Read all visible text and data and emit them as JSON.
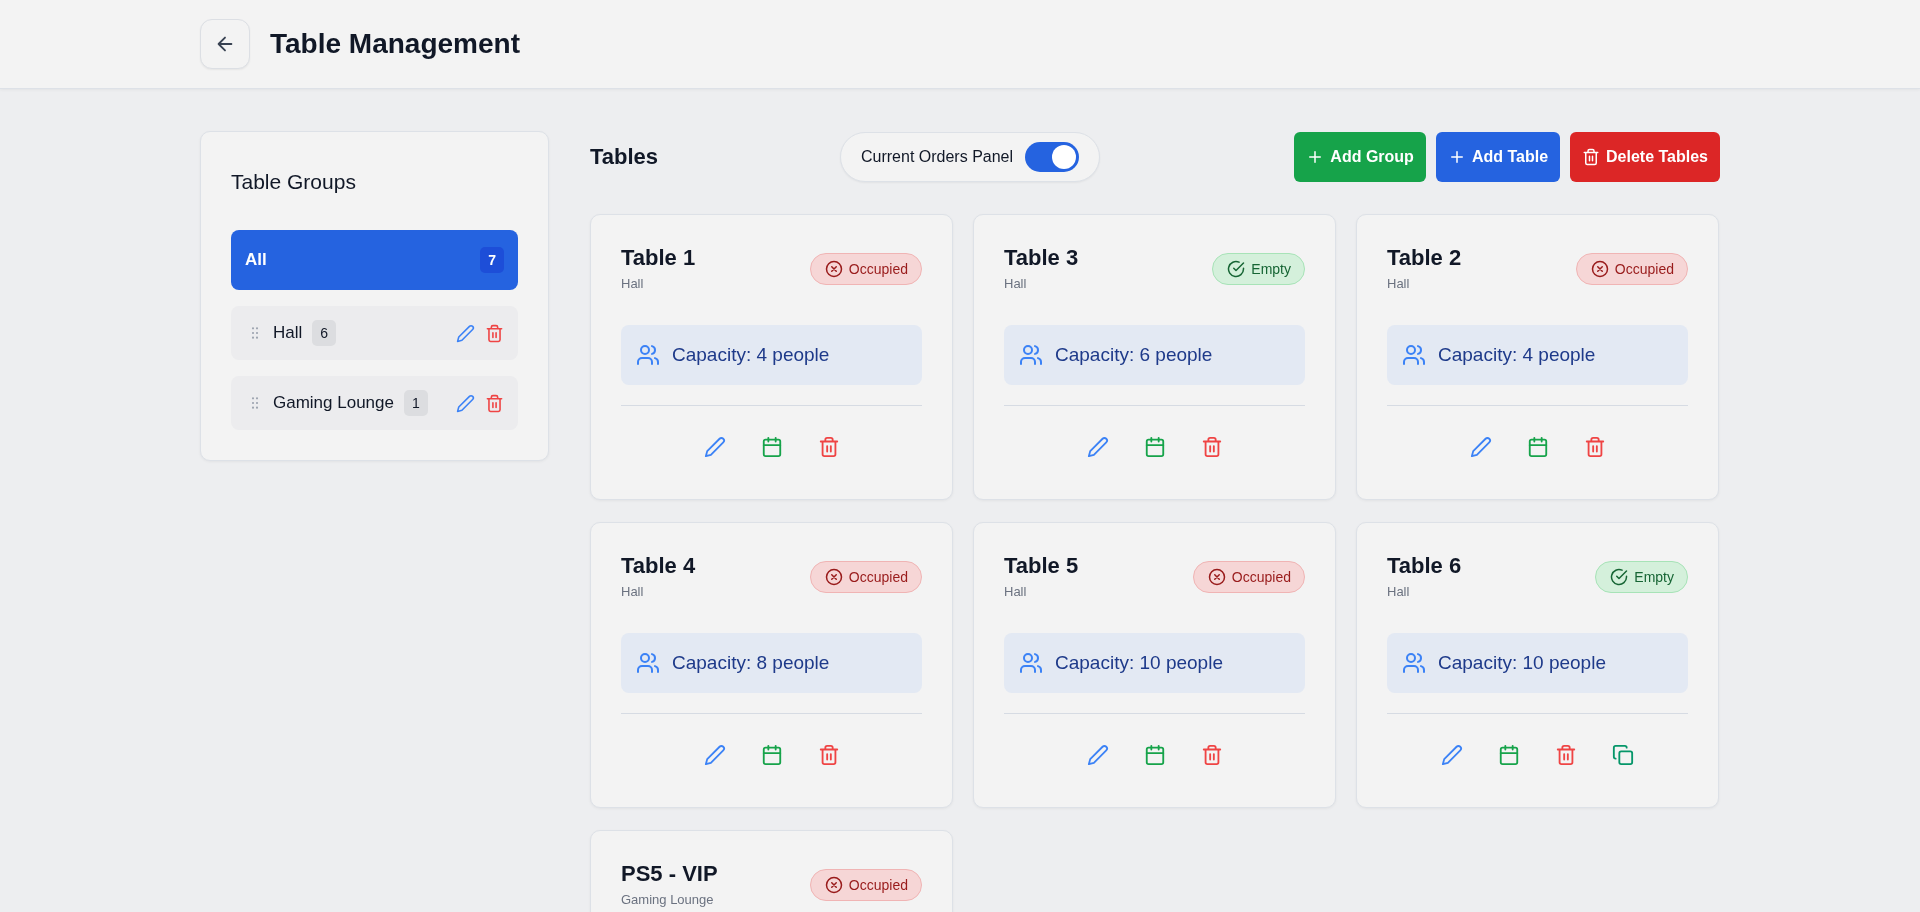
{
  "header": {
    "title": "Table Management"
  },
  "sidebar": {
    "title": "Table Groups",
    "items": [
      {
        "label": "All",
        "count": "7",
        "selected": true,
        "kind": "all"
      },
      {
        "label": "Hall",
        "count": "6",
        "selected": false,
        "kind": "group"
      },
      {
        "label": "Gaming Lounge",
        "count": "1",
        "selected": false,
        "kind": "group"
      }
    ]
  },
  "toolbar": {
    "title": "Tables",
    "panel_toggle": {
      "label": "Current Orders Panel",
      "on": true
    },
    "buttons": [
      {
        "label": "Add Group",
        "kind": "add-group"
      },
      {
        "label": "Add Table",
        "kind": "add-table"
      },
      {
        "label": "Delete Tables",
        "kind": "delete"
      }
    ]
  },
  "tables": [
    {
      "name": "Table 1",
      "group": "Hall",
      "status": "Occupied",
      "kind": "occupied",
      "capacity": "Capacity: 4 people",
      "actions": [
        {
          "kind": "edit"
        },
        {
          "kind": "schedule"
        },
        {
          "kind": "delete"
        }
      ]
    },
    {
      "name": "Table 3",
      "group": "Hall",
      "status": "Empty",
      "kind": "empty",
      "capacity": "Capacity: 6 people",
      "actions": [
        {
          "kind": "edit"
        },
        {
          "kind": "schedule"
        },
        {
          "kind": "delete"
        }
      ]
    },
    {
      "name": "Table 2",
      "group": "Hall",
      "status": "Occupied",
      "kind": "occupied",
      "capacity": "Capacity: 4 people",
      "actions": [
        {
          "kind": "edit"
        },
        {
          "kind": "schedule"
        },
        {
          "kind": "delete"
        }
      ]
    },
    {
      "name": "Table 4",
      "group": "Hall",
      "status": "Occupied",
      "kind": "occupied",
      "capacity": "Capacity: 8 people",
      "actions": [
        {
          "kind": "edit"
        },
        {
          "kind": "schedule"
        },
        {
          "kind": "delete"
        }
      ]
    },
    {
      "name": "Table 5",
      "group": "Hall",
      "status": "Occupied",
      "kind": "occupied",
      "capacity": "Capacity: 10 people",
      "actions": [
        {
          "kind": "edit"
        },
        {
          "kind": "schedule"
        },
        {
          "kind": "delete"
        }
      ]
    },
    {
      "name": "Table 6",
      "group": "Hall",
      "status": "Empty",
      "kind": "empty",
      "capacity": "Capacity: 10 people",
      "actions": [
        {
          "kind": "edit"
        },
        {
          "kind": "schedule"
        },
        {
          "kind": "delete"
        },
        {
          "kind": "copy"
        }
      ]
    },
    {
      "name": "PS5 - VIP",
      "group": "Gaming Lounge",
      "status": "Occupied",
      "kind": "occupied"
    }
  ]
}
